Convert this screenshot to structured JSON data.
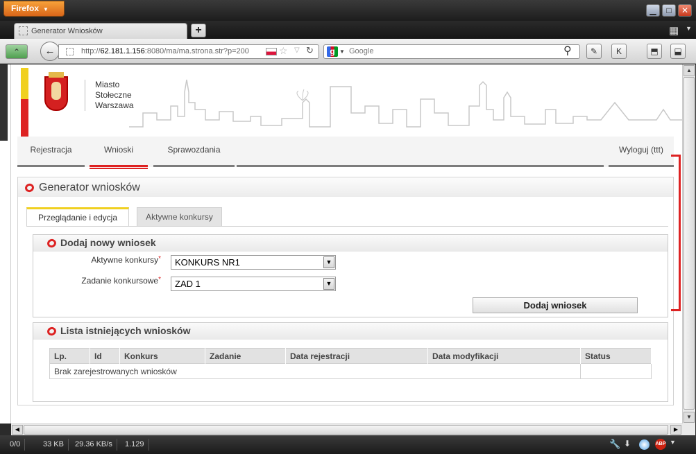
{
  "browser": {
    "menu_label": "Firefox",
    "tab_title": "Generator Wniosków",
    "url_prefix": "http://",
    "url_host": "62.181.1.156",
    "url_rest": ":8080/ma/ma.strona.str?p=200",
    "search_placeholder": "Google",
    "status": {
      "items": "0/0",
      "size": "33 KB",
      "speed": "29.36 KB/s",
      "ratio": "1.129"
    }
  },
  "site": {
    "city_line1": "Miasto",
    "city_line2": "Stołeczne",
    "city_line3": "Warszawa"
  },
  "menu": {
    "items": [
      "Rejestracja",
      "Wnioski",
      "Sprawozdania"
    ],
    "active": "Wnioski",
    "logout": "Wyloguj (ttt)"
  },
  "panel": {
    "title": "Generator wniosków",
    "tabs": [
      "Przeglądanie i edycja",
      "Aktywne konkursy"
    ],
    "add_section": {
      "title": "Dodaj nowy wniosek",
      "field1_label": "Aktywne konkursy",
      "field1_value": "KONKURS NR1",
      "field2_label": "Zadanie konkursowe",
      "field2_value": "ZAD 1",
      "required_mark": "*",
      "button": "Dodaj wniosek"
    },
    "list_section": {
      "title": "Lista istniejących wniosków",
      "columns": [
        "Lp.",
        "Id",
        "Konkurs",
        "Zadanie",
        "Data rejestracji",
        "Data modyfikacji",
        "Status"
      ],
      "empty_message": "Brak zarejestrowanych wniosków"
    }
  },
  "colors": {
    "brand_red": "#dd2222",
    "brand_yellow": "#f0d020"
  }
}
